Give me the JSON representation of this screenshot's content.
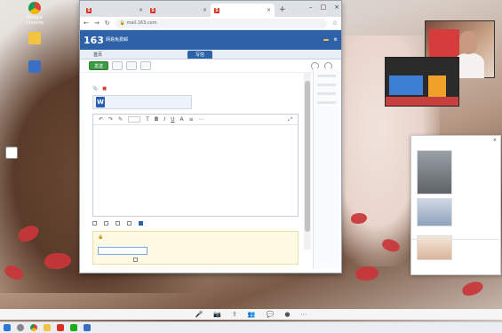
{
  "colors": {
    "accent": "#2e62a8",
    "send": "#3a9b43",
    "tab_favicon": "#d93025"
  },
  "desktop_icons": [
    {
      "label": "Google Chrome",
      "icon": "chrome-icon"
    },
    {
      "label": "",
      "icon": "folder-icon"
    },
    {
      "label": "",
      "icon": "app-icon"
    },
    {
      "label": "",
      "icon": "file-icon"
    }
  ],
  "browser": {
    "tabs": [
      {
        "label": "",
        "active": false
      },
      {
        "label": "",
        "active": false
      },
      {
        "label": "",
        "active": true
      }
    ],
    "new_tab": "+",
    "address": "mail.163.com"
  },
  "mail": {
    "logo": "163",
    "logo_sub": "网易免费邮",
    "account": "",
    "nav_tabs": [
      {
        "label": "首页",
        "active": false
      },
      {
        "label": "",
        "active": false
      },
      {
        "label": "",
        "active": false
      },
      {
        "label": "",
        "active": false
      },
      {
        "label": "",
        "active": false
      },
      {
        "label": "写信",
        "active": true
      }
    ],
    "toolbar": {
      "send": "发送",
      "btn2": "",
      "btn3": "",
      "btn4": ""
    },
    "editor": {
      "font": ""
    },
    "attachment_file": {
      "name": "",
      "size": ""
    },
    "password_value": "",
    "options": [
      "",
      "",
      "",
      "",
      ""
    ]
  },
  "chat": {
    "title": ""
  },
  "taskbar": {
    "time": "",
    "date": ""
  }
}
